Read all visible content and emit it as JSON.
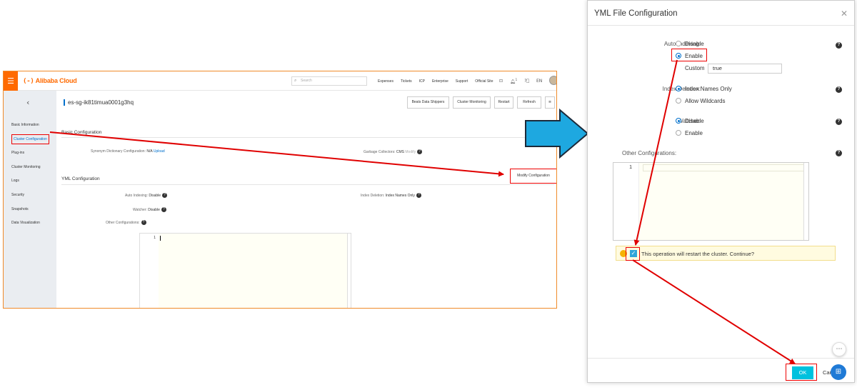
{
  "console": {
    "brand": "Alibaba Cloud",
    "brand_mark": "(-)",
    "menu_icon": "hamburger-icon",
    "search_placeholder": "Search",
    "nav_links": [
      "Expenses",
      "Tickets",
      "ICP",
      "Enterprise",
      "Support",
      "Official Site"
    ],
    "nav_icons": [
      "terminal-icon",
      "bell-icon",
      "help-icon"
    ],
    "notification_count": "1",
    "language": "EN",
    "back_icon": "chevron-left-icon",
    "cluster_id": "es-sg-ik81timua0001g3hq",
    "actions": [
      "Beats Data Shippers",
      "Cluster Monitoring",
      "Restart",
      "Refresh"
    ],
    "more_icon": "list-icon",
    "sidebar_items": [
      "Basic Information",
      "Cluster Configuration",
      "Plug-ins",
      "Cluster Monitoring",
      "Logs",
      "Security",
      "Snapshots",
      "Data Visualization"
    ],
    "active_item": "Cluster Configuration",
    "basic_section": {
      "title": "Basic Configuration",
      "synonym_label": "Synonym Dictionary Configuration:",
      "synonym_value": "N/A",
      "synonym_link": "Upload",
      "gc_label": "Garbage Collectors:",
      "gc_value": "CMS",
      "gc_link": "Modify"
    },
    "yml_section": {
      "title": "YML Configuration",
      "modify_button": "Modify Configuration",
      "auto_indexing_label": "Auto Indexing:",
      "auto_indexing_value": "Disable",
      "index_deletion_label": "Index Deletion:",
      "index_deletion_value": "Index Names Only",
      "watcher_label": "Watcher:",
      "watcher_value": "Disable",
      "other_label": "Other Configurations:",
      "line_number": "1"
    }
  },
  "dialog": {
    "title": "YML File Configuration",
    "close_icon": "close-icon",
    "auto_indexing": {
      "label": "Auto Indexing:",
      "options": [
        "Disable",
        "Enable",
        "Custom"
      ],
      "selected": "Enable",
      "custom_value": "true"
    },
    "index_deletion": {
      "label": "Index Deletion:",
      "options": [
        "Index Names Only",
        "Allow Wildcards"
      ],
      "selected": "Index Names Only"
    },
    "watcher": {
      "label": "Watcher:",
      "options": [
        "Disable",
        "Enable"
      ],
      "selected": "Disable"
    },
    "other_label": "Other Configurations:",
    "line_number": "1",
    "warning_text": "This operation will restart the cluster. Continue?",
    "warning_checked": true,
    "help_glyph": "?",
    "ok_label": "OK",
    "cancel_label": "Cancel",
    "chat_icon": "chat-icon",
    "apps_icon": "apps-icon"
  },
  "annotation_colors": {
    "highlight": "#e00000",
    "arrow_fill": "#1ea8e0"
  }
}
